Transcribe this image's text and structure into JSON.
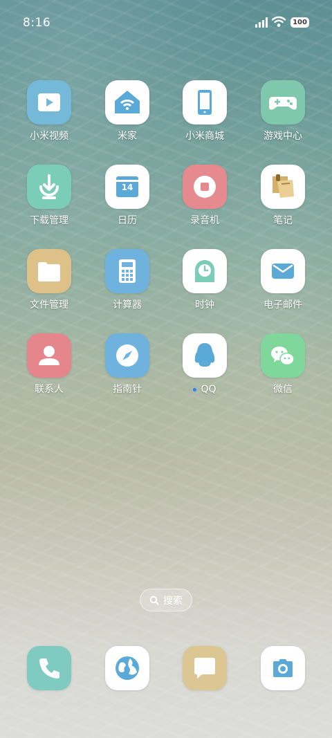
{
  "status_bar": {
    "time": "8:16",
    "battery": "100"
  },
  "apps": [
    {
      "id": "mi-video",
      "label": "小米视频",
      "icon": "play-video-icon",
      "color": "#74b9d8"
    },
    {
      "id": "mi-home",
      "label": "米家",
      "icon": "smart-home-icon",
      "color": "#ffffff"
    },
    {
      "id": "mi-store",
      "label": "小米商城",
      "icon": "phone-store-icon",
      "color": "#ffffff"
    },
    {
      "id": "game-center",
      "label": "游戏中心",
      "icon": "gamepad-icon",
      "color": "#7fc8ad"
    },
    {
      "id": "downloads",
      "label": "下载管理",
      "icon": "download-icon",
      "color": "#7ccdb8"
    },
    {
      "id": "calendar",
      "label": "日历",
      "icon": "calendar-icon",
      "color": "#ffffff",
      "date": "14"
    },
    {
      "id": "recorder",
      "label": "录音机",
      "icon": "record-icon",
      "color": "#e58a8e"
    },
    {
      "id": "notes",
      "label": "笔记",
      "icon": "notes-icon",
      "color": "#ffffff"
    },
    {
      "id": "file-manager",
      "label": "文件管理",
      "icon": "folder-icon",
      "color": "#dec188"
    },
    {
      "id": "calculator",
      "label": "计算器",
      "icon": "calculator-icon",
      "color": "#6eb2dd"
    },
    {
      "id": "clock",
      "label": "时钟",
      "icon": "clock-icon",
      "color": "#ffffff"
    },
    {
      "id": "email",
      "label": "电子邮件",
      "icon": "mail-icon",
      "color": "#ffffff"
    },
    {
      "id": "contacts",
      "label": "联系人",
      "icon": "person-icon",
      "color": "#e4868c"
    },
    {
      "id": "compass",
      "label": "指南针",
      "icon": "compass-icon",
      "color": "#6eb2dd"
    },
    {
      "id": "qq",
      "label": "QQ",
      "icon": "qq-penguin-icon",
      "color": "#ffffff",
      "new_badge": true
    },
    {
      "id": "wechat",
      "label": "微信",
      "icon": "wechat-icon",
      "color": "#7fd79c"
    }
  ],
  "search": {
    "label": "搜索"
  },
  "dock": [
    {
      "id": "phone",
      "icon": "phone-icon",
      "color": "#7fcbc1"
    },
    {
      "id": "browser",
      "icon": "globe-icon",
      "color": "#ffffff"
    },
    {
      "id": "messages",
      "icon": "message-icon",
      "color": "#dcc694"
    },
    {
      "id": "camera",
      "icon": "camera-icon",
      "color": "#ffffff"
    }
  ]
}
